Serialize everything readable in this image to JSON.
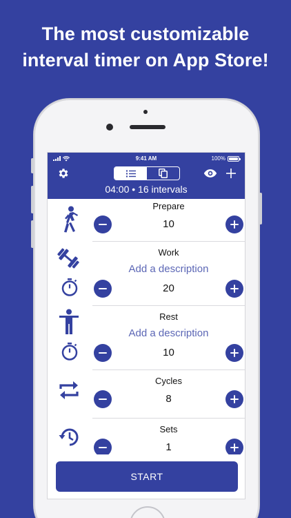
{
  "headline": {
    "line1": "The most customizable",
    "line2": "interval timer on App Store!"
  },
  "status_bar": {
    "time": "9:41 AM",
    "battery": "100%"
  },
  "toolbar": {
    "settings_icon": "gear-icon",
    "segment_list_icon": "list-icon",
    "segment_copy_icon": "copy-icon",
    "preview_icon": "eye-icon",
    "add_icon": "plus-icon"
  },
  "summary": "04:00 • 16 intervals",
  "sections": [
    {
      "title": "Prepare",
      "description": "",
      "value": "10"
    },
    {
      "title": "Work",
      "description": "Add a description",
      "value": "20"
    },
    {
      "title": "Rest",
      "description": "Add a description",
      "value": "10"
    },
    {
      "title": "Cycles",
      "description": "",
      "value": "8"
    },
    {
      "title": "Sets",
      "description": "",
      "value": "1"
    }
  ],
  "start_label": "START",
  "colors": {
    "brand": "#3441a0",
    "accent_text": "#5b66b5",
    "background": "#ffffff"
  }
}
